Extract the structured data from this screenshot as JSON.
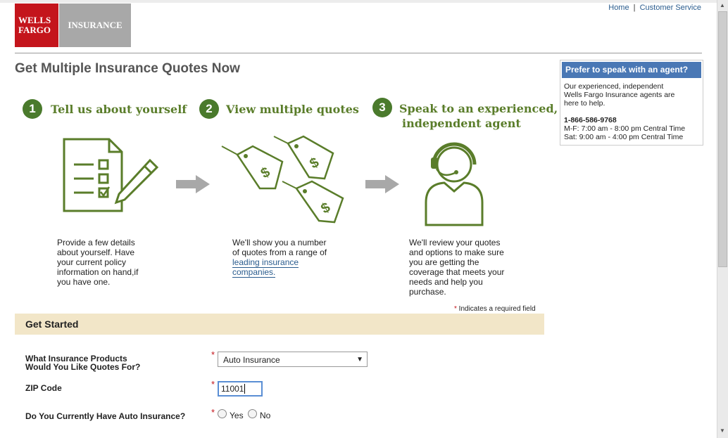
{
  "brand": {
    "logo_line1": "WELLS",
    "logo_line2": "FARGO",
    "logo_product": "INSURANCE"
  },
  "toplinks": {
    "home": "Home",
    "sep": "|",
    "customer_service": "Customer Service"
  },
  "page_title": "Get Multiple Insurance Quotes Now",
  "steps": [
    {
      "num": "1",
      "title_line1": "Tell us about yourself",
      "title_line2": "",
      "icon": "checklist-icon",
      "desc": [
        "Provide a few details",
        "about yourself. Have",
        "your current policy",
        "information on hand,if",
        "you have one."
      ]
    },
    {
      "num": "2",
      "title_line1": "View multiple quotes",
      "title_line2": "",
      "icon": "price-tags-icon",
      "desc": [
        "We'll show you a number",
        "of quotes from a range of"
      ],
      "link": [
        "leading insurance",
        "companies."
      ]
    },
    {
      "num": "3",
      "title_line1": "Speak to an experienced,",
      "title_line2": "independent agent",
      "icon": "agent-headset-icon",
      "desc": [
        "We'll review your quotes",
        "and options to make sure",
        "you are getting the",
        "coverage that meets your",
        "needs and help you",
        "purchase."
      ]
    }
  ],
  "required_note": {
    "star": "*",
    "text": " Indicates a required field"
  },
  "get_started": "Get Started",
  "form": {
    "products_label_line1": "What Insurance Products",
    "products_label_line2": "Would You Like Quotes For?",
    "products_value": "Auto Insurance",
    "zip_label": "ZIP Code",
    "zip_value": "11001",
    "auto_label": "Do You Currently Have Auto Insurance?",
    "yes": "Yes",
    "no": "No",
    "star": "*"
  },
  "agent": {
    "header": "Prefer to speak with an agent?",
    "line1": "Our experienced, independent",
    "line2": "Wells Fargo Insurance agents are",
    "line3": "here to help.",
    "phone": "1-866-586-9768",
    "hours1": "M-F: 7:00 am - 8:00 pm Central Time",
    "hours2": "Sat: 9:00 am - 4:00 pm Central Time"
  },
  "colors": {
    "brand_red": "#c4151c",
    "accent_green": "#5a7d2a",
    "header_blue": "#4a78b5",
    "band": "#f2e6c8"
  }
}
